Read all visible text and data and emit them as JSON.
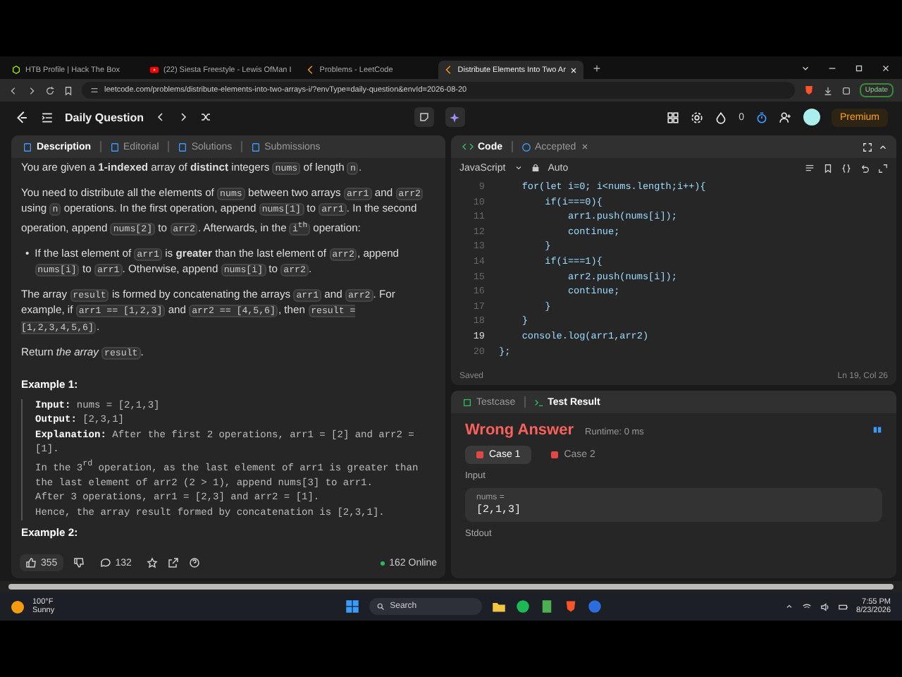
{
  "browser": {
    "tabs": [
      {
        "title": "HTB Profile | Hack The Box",
        "selected": false
      },
      {
        "title": "(22) Siesta Freestyle - Lewis OfMan I",
        "selected": false
      },
      {
        "title": "Problems - LeetCode",
        "selected": false
      },
      {
        "title": "Distribute Elements Into Two Ar",
        "selected": true
      }
    ],
    "url": "leetcode.com/problems/distribute-elements-into-two-arrays-i/?envType=daily-question&envId=2026-08-20",
    "update_button": "Update"
  },
  "nav": {
    "title": "Daily Question",
    "streak": "0",
    "premium": "Premium"
  },
  "description_panel": {
    "tabs": [
      {
        "label": "Description",
        "selected": true
      },
      {
        "label": "Editorial",
        "selected": false
      },
      {
        "label": "Solutions",
        "selected": false
      },
      {
        "label": "Submissions",
        "selected": false
      }
    ],
    "paragraphs": [
      {
        "kind": "paragraph",
        "segments": [
          {
            "kind": "text",
            "text": "You are given a **1-indexed** array of **distinct** integers "
          },
          {
            "kind": "code",
            "text": "nums"
          },
          {
            "kind": "text",
            "text": " of length "
          },
          {
            "kind": "code",
            "text": "n"
          },
          {
            "kind": "text",
            "text": "."
          }
        ]
      },
      {
        "kind": "paragraph",
        "segments": [
          {
            "kind": "text",
            "text": "You need to distribute all the elements of "
          },
          {
            "kind": "code",
            "text": "nums"
          },
          {
            "kind": "text",
            "text": " between two arrays "
          },
          {
            "kind": "code",
            "text": "arr1"
          },
          {
            "kind": "text",
            "text": " and "
          },
          {
            "kind": "code",
            "text": "arr2"
          },
          {
            "kind": "text",
            "text": " using "
          },
          {
            "kind": "code",
            "text": "n"
          },
          {
            "kind": "text",
            "text": " operations. In the first operation, append "
          },
          {
            "kind": "code",
            "text": "nums[1]"
          },
          {
            "kind": "text",
            "text": " to "
          },
          {
            "kind": "code",
            "text": "arr1"
          },
          {
            "kind": "text",
            "text": ". In the second operation, append "
          },
          {
            "kind": "code",
            "text": "nums[2]"
          },
          {
            "kind": "text",
            "text": " to "
          },
          {
            "kind": "code",
            "text": "arr2"
          },
          {
            "kind": "text",
            "text": ". Afterwards, in the "
          },
          {
            "kind": "code",
            "text": "i$^{th}$"
          },
          {
            "kind": "text",
            "text": " operation:"
          }
        ]
      },
      {
        "kind": "bullet",
        "marker": "•",
        "segments": [
          {
            "kind": "text",
            "text": "If the last element of "
          },
          {
            "kind": "code",
            "text": "arr1"
          },
          {
            "kind": "text",
            "text": " is **greater** than the last element of "
          },
          {
            "kind": "code",
            "text": "arr2"
          },
          {
            "kind": "text",
            "text": ", append "
          },
          {
            "kind": "code",
            "text": "nums[i]"
          },
          {
            "kind": "text",
            "text": " to "
          },
          {
            "kind": "code",
            "text": "arr1"
          },
          {
            "kind": "text",
            "text": ". Otherwise, append "
          },
          {
            "kind": "code",
            "text": "nums[i]"
          },
          {
            "kind": "text",
            "text": " to "
          },
          {
            "kind": "code",
            "text": "arr2"
          },
          {
            "kind": "text",
            "text": "."
          }
        ]
      },
      {
        "kind": "paragraph",
        "segments": [
          {
            "kind": "text",
            "text": "The array "
          },
          {
            "kind": "code",
            "text": "result"
          },
          {
            "kind": "text",
            "text": " is formed by concatenating the arrays "
          },
          {
            "kind": "code",
            "text": "arr1"
          },
          {
            "kind": "text",
            "text": " and "
          },
          {
            "kind": "code",
            "text": "arr2"
          },
          {
            "kind": "text",
            "text": ". For example, if "
          },
          {
            "kind": "code",
            "text": "arr1 == [1,2,3]"
          },
          {
            "kind": "text",
            "text": " and "
          },
          {
            "kind": "code",
            "text": "arr2 == [4,5,6]"
          },
          {
            "kind": "text",
            "text": ", then "
          },
          {
            "kind": "code",
            "text": "result = [1,2,3,4,5,6]"
          },
          {
            "kind": "text",
            "text": "."
          }
        ]
      },
      {
        "kind": "paragraph",
        "segments": [
          {
            "kind": "text",
            "text": "Return *the array* "
          },
          {
            "kind": "code",
            "text": "result"
          },
          {
            "kind": "text",
            "text": "."
          }
        ]
      }
    ],
    "example": {
      "heading": "Example 1:",
      "lines": [
        "**Input:** nums = [2,1,3]",
        "**Output:** [2,3,1]",
        "**Explanation:** After the first 2 operations, arr1 = [2] and arr2 = [1].",
        "In the 3$^{rd}$ operation, as the last element of arr1 is greater than the last element of arr2 (2 > 1), append nums[3] to arr1.",
        "After 3 operations, arr1 = [2,3] and arr2 = [1].",
        "Hence, the array result formed by concatenation is [2,3,1]."
      ]
    },
    "next_heading": "Example 2:",
    "likes": "355",
    "comments": "132",
    "online": "162 Online"
  },
  "code_panel": {
    "tabs": [
      {
        "label": "Code",
        "selected": true
      },
      {
        "label": "Accepted",
        "selected": false
      }
    ],
    "language": "JavaScript",
    "mode": "Auto",
    "lines": [
      {
        "number": "9",
        "text": "    for(let i=0; i<nums.length;i++){",
        "current": false
      },
      {
        "number": "10",
        "text": "        if(i===0){",
        "current": false
      },
      {
        "number": "11",
        "text": "            arr1.push(nums[i]);",
        "current": false
      },
      {
        "number": "12",
        "text": "            continue;",
        "current": false
      },
      {
        "number": "13",
        "text": "        }",
        "current": false
      },
      {
        "number": "14",
        "text": "        if(i===1){",
        "current": false
      },
      {
        "number": "15",
        "text": "            arr2.push(nums[i]);",
        "current": false
      },
      {
        "number": "16",
        "text": "            continue;",
        "current": false
      },
      {
        "number": "17",
        "text": "        }",
        "current": false
      },
      {
        "number": "18",
        "text": "    }",
        "current": false
      },
      {
        "number": "19",
        "text": "    console.log(arr1,arr2)",
        "current": true
      },
      {
        "number": "20",
        "text": "};",
        "current": false
      }
    ],
    "status": "Saved",
    "cursor": "Ln 19, Col 26"
  },
  "test_panel": {
    "tabs": [
      {
        "label": "Testcase",
        "selected": false
      },
      {
        "label": "Test Result",
        "selected": true
      }
    ],
    "verdict": "Wrong Answer",
    "runtime": "Runtime: 0 ms",
    "cases": [
      {
        "label": "Case 1",
        "selected": true
      },
      {
        "label": "Case 2",
        "selected": false
      }
    ],
    "input_label": "Input",
    "input_name": "nums =",
    "input_value": "[2,1,3]",
    "stdout_label": "Stdout"
  },
  "taskbar": {
    "temperature": "100°F",
    "weather": "Sunny",
    "search": "Search",
    "time": "7:55 PM",
    "date": "8/23/2026"
  }
}
